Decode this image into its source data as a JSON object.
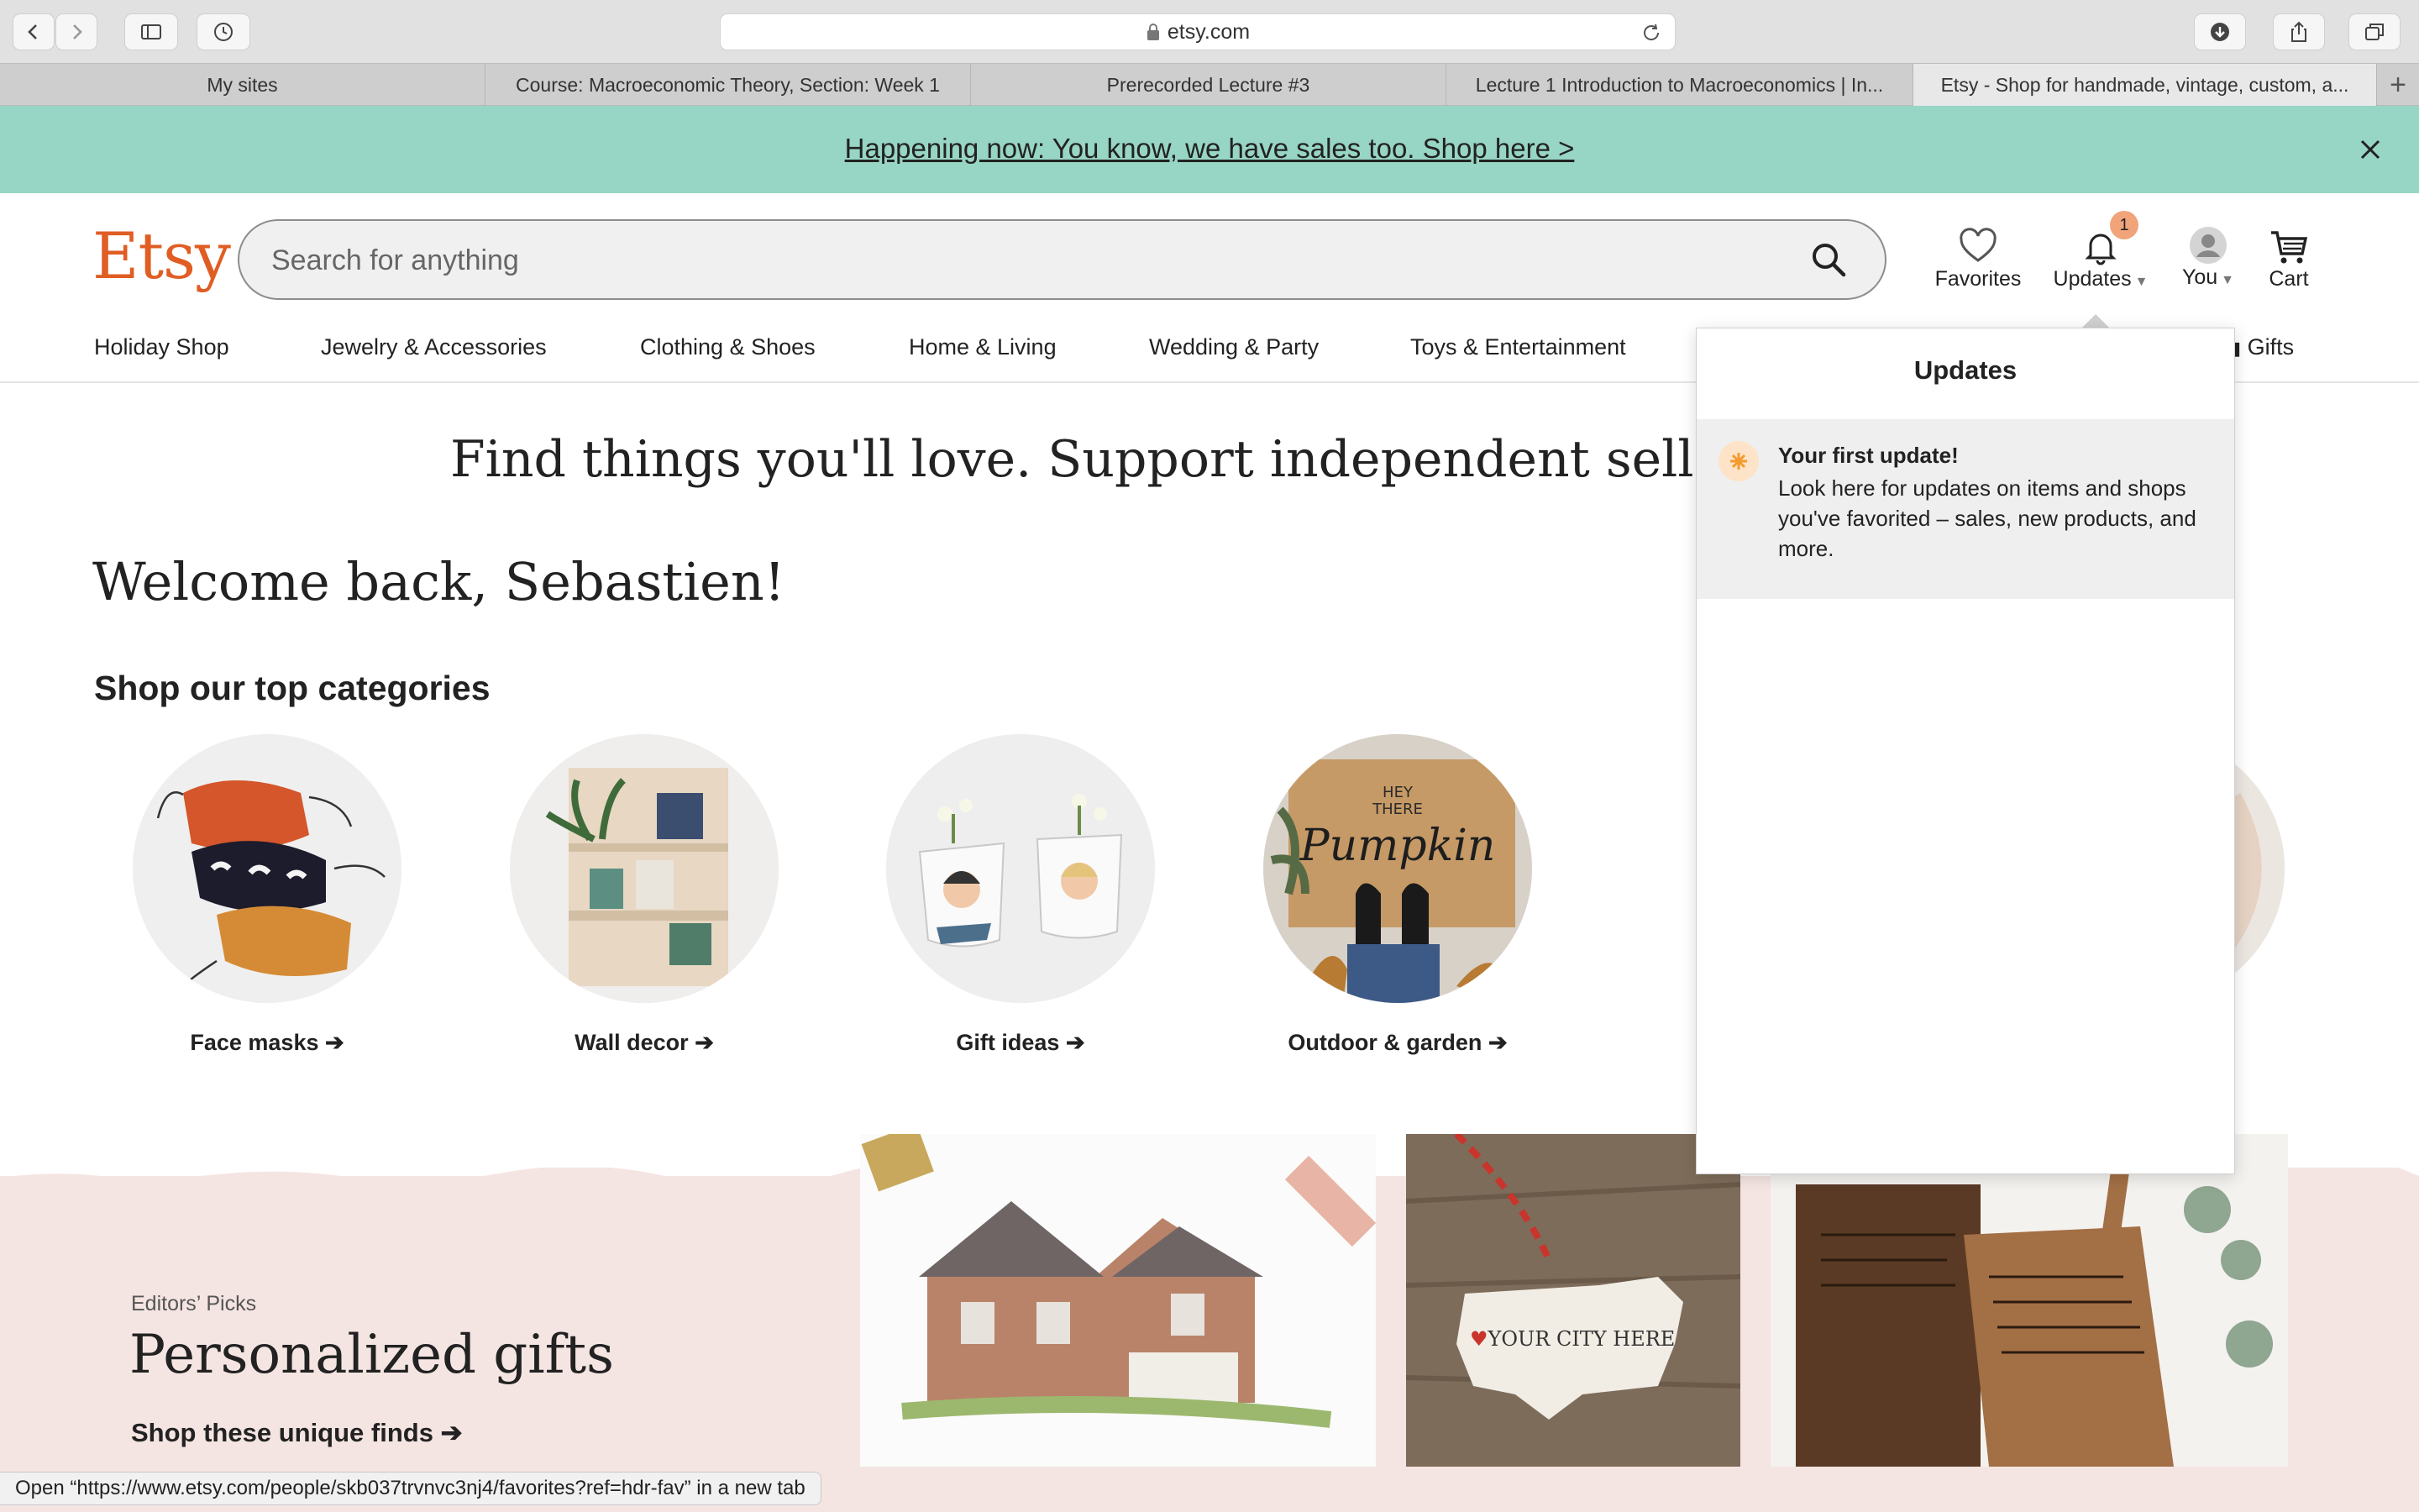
{
  "browser": {
    "url": "etsy.com",
    "tabs": [
      {
        "label": "My sites"
      },
      {
        "label": "Course: Macroeconomic Theory, Section: Week 1"
      },
      {
        "label": "Prerecorded Lecture #3"
      },
      {
        "label": "Lecture 1 Introduction to Macroeconomics | In..."
      },
      {
        "label": "Etsy - Shop for handmade, vintage, custom, a..."
      }
    ],
    "status_text": "Open “https://www.etsy.com/people/skb037trvnvc3nj4/favorites?ref=hdr-fav” in a new tab"
  },
  "banner": {
    "text": "Happening now: You know, we have sales too. Shop here >"
  },
  "header": {
    "logo": "Etsy",
    "search_placeholder": "Search for anything",
    "favorites": "Favorites",
    "updates": "Updates",
    "updates_badge": "1",
    "you": "You",
    "cart": "Cart"
  },
  "nav": {
    "items": [
      "Holiday Shop",
      "Jewelry & Accessories",
      "Clothing & Shoes",
      "Home & Living",
      "Wedding & Party",
      "Toys & Entertainment"
    ],
    "gifts": "Gifts"
  },
  "main": {
    "tagline": "Find things you'll love. Support independent sellers. O",
    "welcome": "Welcome back, Sebastien!",
    "section_title": "Shop our top categories",
    "categories": [
      {
        "label": "Face masks"
      },
      {
        "label": "Wall decor"
      },
      {
        "label": "Gift ideas"
      },
      {
        "label": "Outdoor & garden"
      }
    ]
  },
  "editors": {
    "kicker": "Editors’ Picks",
    "title": "Personalized gifts",
    "link": "Shop these unique finds",
    "tile_text": "YOUR CITY HERE"
  },
  "updates_panel": {
    "title": "Updates",
    "item_title": "Your first update!",
    "item_body": "Look here for updates on items and shops you've favorited – sales, new products, and more."
  },
  "colors": {
    "brand": "#e05d23",
    "banner": "#97d5c4",
    "pink_band": "#f5e5e2",
    "badge": "#f1a47a"
  }
}
